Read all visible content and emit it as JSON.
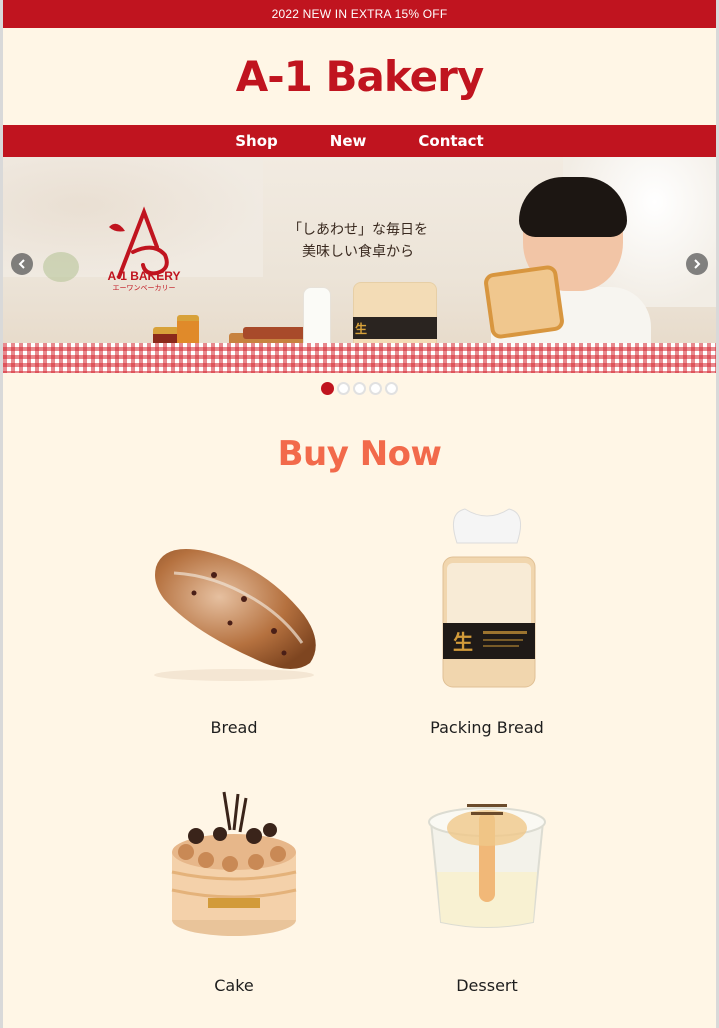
{
  "promo": {
    "text": "2022 NEW IN EXTRA 15% OFF"
  },
  "header": {
    "logo": "A-1 Bakery"
  },
  "nav": {
    "items": [
      {
        "label": "Shop"
      },
      {
        "label": "New"
      },
      {
        "label": "Contact"
      }
    ]
  },
  "carousel": {
    "brand_name": "A-1 BAKERY",
    "brand_sub": "エーワンベーカリー",
    "tagline_line1": "「しあわせ」な毎日を",
    "tagline_line2": "美味しい食卓から",
    "bag_text": "生",
    "slide_count": 5,
    "active_slide": 1,
    "prev_icon": "chevron-left-icon",
    "next_icon": "chevron-right-icon"
  },
  "section": {
    "title": "Buy Now"
  },
  "products": [
    {
      "label": "Bread"
    },
    {
      "label": "Packing Bread"
    },
    {
      "label": "Cake"
    },
    {
      "label": "Dessert"
    }
  ],
  "colors": {
    "brand_red": "#c0141f",
    "title_orange": "#f26a4b",
    "background": "#fff6e6"
  }
}
